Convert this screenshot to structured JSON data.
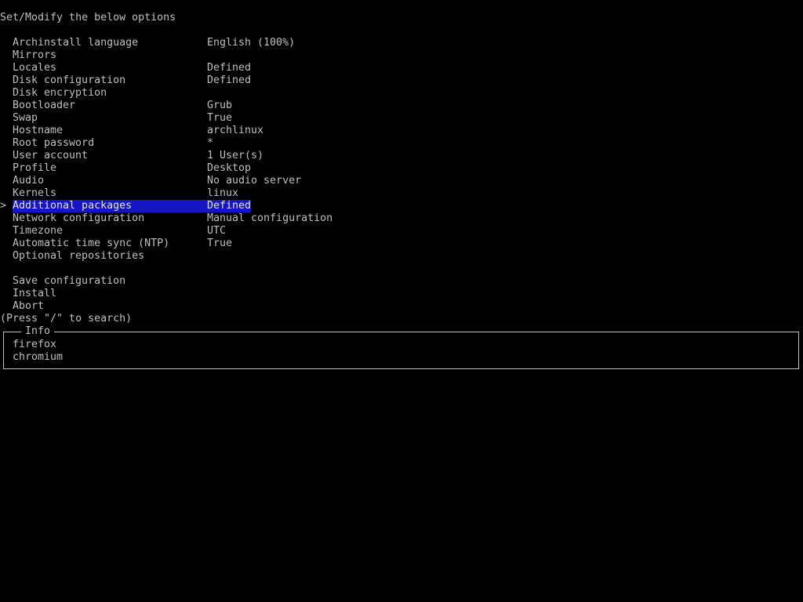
{
  "header": {
    "title": "Set/Modify the below options"
  },
  "menu": {
    "cursor": ">",
    "items": [
      {
        "label": "Archinstall language",
        "value": "English (100%)"
      },
      {
        "label": "Mirrors",
        "value": ""
      },
      {
        "label": "Locales",
        "value": "Defined"
      },
      {
        "label": "Disk configuration",
        "value": "Defined"
      },
      {
        "label": "Disk encryption",
        "value": ""
      },
      {
        "label": "Bootloader",
        "value": "Grub"
      },
      {
        "label": "Swap",
        "value": "True"
      },
      {
        "label": "Hostname",
        "value": "archlinux"
      },
      {
        "label": "Root password",
        "value": "*"
      },
      {
        "label": "User account",
        "value": "1 User(s)"
      },
      {
        "label": "Profile",
        "value": "Desktop"
      },
      {
        "label": "Audio",
        "value": "No audio server"
      },
      {
        "label": "Kernels",
        "value": "linux"
      },
      {
        "label": "Additional packages",
        "value": "Defined"
      },
      {
        "label": "Network configuration",
        "value": "Manual configuration"
      },
      {
        "label": "Timezone",
        "value": "UTC"
      },
      {
        "label": "Automatic time sync (NTP)",
        "value": "True"
      },
      {
        "label": "Optional repositories",
        "value": ""
      }
    ],
    "actions": [
      {
        "label": "Save configuration"
      },
      {
        "label": "Install"
      },
      {
        "label": "Abort"
      }
    ]
  },
  "hint": "(Press \"/\" to search)",
  "info": {
    "title": "Info",
    "lines": [
      "firefox",
      "chromium"
    ]
  },
  "colors": {
    "background": "#000000",
    "text": "#bfbfbf",
    "selection": "#1515c8"
  }
}
